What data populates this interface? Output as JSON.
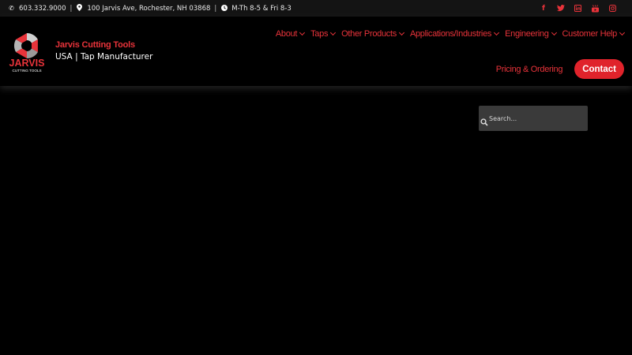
{
  "topbar": {
    "phone": "603.332.9000",
    "address": "100 Jarvis Ave, Rochester, NH 03868",
    "hours": "M-Th 8-5 & Fri 8-3",
    "separator": "|",
    "social": [
      {
        "name": "facebook-icon",
        "glyph": "f"
      },
      {
        "name": "twitter-icon",
        "glyph": "t"
      },
      {
        "name": "linkedin-icon",
        "glyph": "in"
      },
      {
        "name": "youtube-icon",
        "glyph": "▶"
      },
      {
        "name": "instagram-icon",
        "glyph": "◎"
      }
    ]
  },
  "brand": {
    "logo_text": "JARVIS",
    "logo_subtext": "CUTTING TOOLS",
    "name": "Jarvis Cutting Tools",
    "tagline": "USA | Tap Manufacturer"
  },
  "nav": {
    "items": [
      {
        "label": "About"
      },
      {
        "label": "Taps"
      },
      {
        "label": "Other Products"
      },
      {
        "label": "Applications/Industries"
      },
      {
        "label": "Engineering"
      },
      {
        "label": "Customer Help"
      }
    ],
    "pricing": "Pricing & Ordering",
    "contact": "Contact"
  },
  "search": {
    "placeholder": "Search..."
  },
  "colors": {
    "accent": "#e8333a",
    "contact_bg": "#e0232b",
    "background": "#000000",
    "topbar_bg": "#141414",
    "search_bg": "#3a3a3a"
  }
}
